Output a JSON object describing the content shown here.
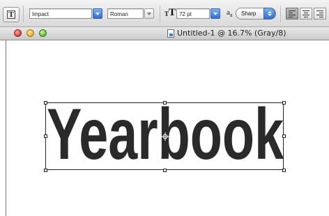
{
  "options_bar": {
    "tool_icon": "type-tool-icon",
    "font_family": "Impact",
    "font_style": "Roman",
    "font_size": "72 pt",
    "antialias_label": "a",
    "antialias_sub": "a",
    "antialias_method": "Sharp",
    "size_icon_big": "T",
    "size_icon_small": "T"
  },
  "document": {
    "title": "Untitled-1 @ 16.7% (Gray/8)"
  },
  "canvas": {
    "text_layer": "Yearbook",
    "text_color": "#2a2a2a"
  }
}
